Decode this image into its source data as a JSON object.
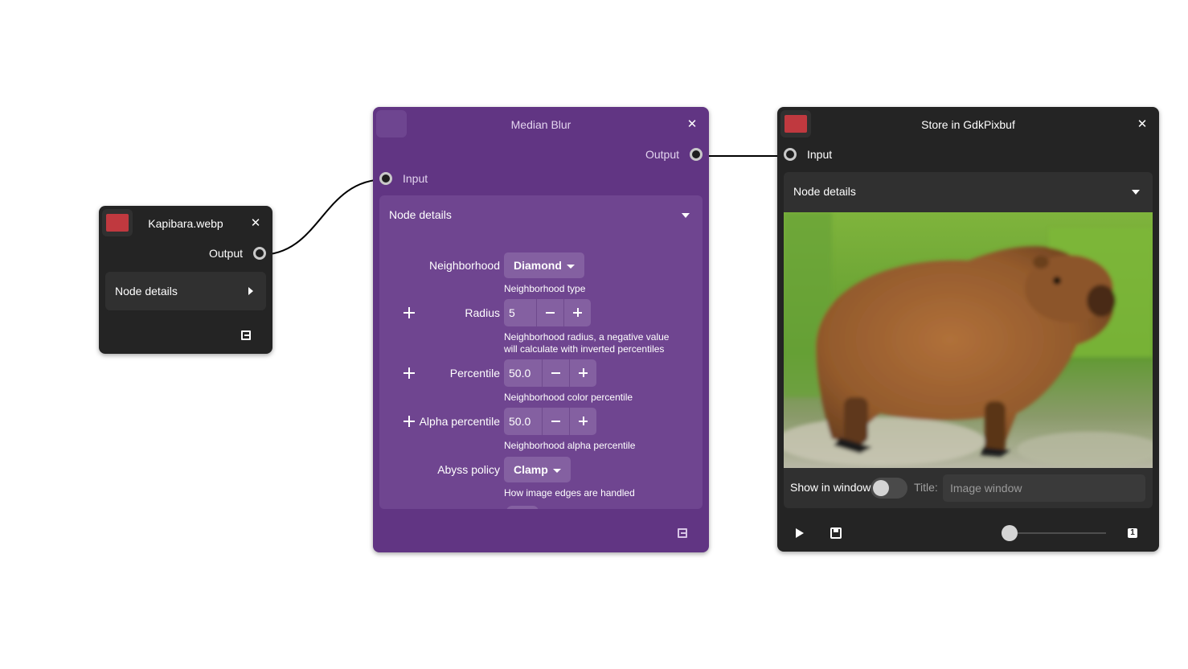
{
  "colors": {
    "canvas": "#ffffff",
    "node_dark": "#242424",
    "node_purple": "#613583",
    "swatch_red": "#c0393f",
    "wire": "#000000"
  },
  "kapibara": {
    "title": "Kapibara.webp",
    "output_label": "Output",
    "details_label": "Node details",
    "icons": {
      "close": "close-icon",
      "expander": "chevron-right-icon",
      "export": "export-icon"
    }
  },
  "median_blur": {
    "title": "Median Blur",
    "output_label": "Output",
    "input_label": "Input",
    "details_label": "Node details",
    "neighborhood": {
      "label": "Neighborhood",
      "value": "Diamond",
      "description": "Neighborhood type"
    },
    "radius": {
      "label": "Radius",
      "value": "5",
      "description_line1": "Neighborhood radius, a negative value",
      "description_line2": "will calculate with inverted percentiles"
    },
    "percentile": {
      "label": "Percentile",
      "value": "50.0",
      "description": "Neighborhood color percentile"
    },
    "alpha_percentile": {
      "label": "Alpha percentile",
      "value": "50.0",
      "description": "Neighborhood alpha percentile"
    },
    "abyss_policy": {
      "label": "Abyss policy",
      "value": "Clamp",
      "description": "How image edges are handled"
    }
  },
  "store": {
    "title": "Store in GdkPixbuf",
    "input_label": "Input",
    "details_label": "Node details",
    "show_in_window_label": "Show in window",
    "show_in_window_on": false,
    "title_label": "Title:",
    "title_placeholder": "Image window",
    "slider_value": 0,
    "icons": {
      "play": "play-icon",
      "save": "save-icon",
      "normal_size": "zoom-original-icon"
    }
  }
}
